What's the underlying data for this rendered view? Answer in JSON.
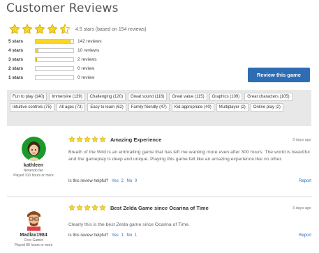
{
  "page": {
    "title": "Customer Reviews"
  },
  "summary": {
    "rating_text": "4.5 stars (based on 154 reviews)",
    "rating": 4.5,
    "star_color": "#f6d52a"
  },
  "breakdown": [
    {
      "label": "5 stars",
      "count_text": "142 reviews",
      "fraction": 0.92
    },
    {
      "label": "4 stars",
      "count_text": "10 reviews",
      "fraction": 0.065
    },
    {
      "label": "3 stars",
      "count_text": "2 reviews",
      "fraction": 0.03
    },
    {
      "label": "2 stars",
      "count_text": "0 review",
      "fraction": 0
    },
    {
      "label": "1 stars",
      "count_text": "0 review",
      "fraction": 0
    }
  ],
  "actions": {
    "review_button": "Review this game",
    "accent": "#2e6db3"
  },
  "tags": [
    "Fun to play (140)",
    "Immersive (139)",
    "Challenging (120)",
    "Great sound (116)",
    "Great value (115)",
    "Graphics (109)",
    "Great characters (105)",
    "Intuitive controls (75)",
    "All ages (73)",
    "Easy to learn (62)",
    "Family friendly (47)",
    "Kid appropriate (40)",
    "Multiplayer (2)",
    "Online play (2)"
  ],
  "reviews": [
    {
      "name": "kathleen",
      "role": "Nintendo fan",
      "played": "Played 310 hours or more",
      "rating": 5,
      "title": "Amazing Experience",
      "date": "3 days ago",
      "body": "Breath of the Wild is an enthralling game that has left me wanting more even after 300 hours. The world is beautiful and the gameplay is deep and unique. Playing this game felt like an amazing experience like no other.",
      "helpful_q": "Is this review helpful?",
      "yes_label": "Yes",
      "yes_count": "2",
      "no_label": "No",
      "no_count": "0",
      "report": "Report"
    },
    {
      "name": "Madlax1984",
      "role": "Core Gamer",
      "played": "Played 80 hours or more",
      "rating": 5,
      "title": "Best Zelda Game since Ocarina of Time",
      "date": "3 days ago",
      "body": "Clearly this is the best Zelda game since Ocarina of Time.",
      "helpful_q": "Is this review helpful?",
      "yes_label": "Yes",
      "yes_count": "1",
      "no_label": "No",
      "no_count": "1",
      "report": "Report"
    }
  ]
}
